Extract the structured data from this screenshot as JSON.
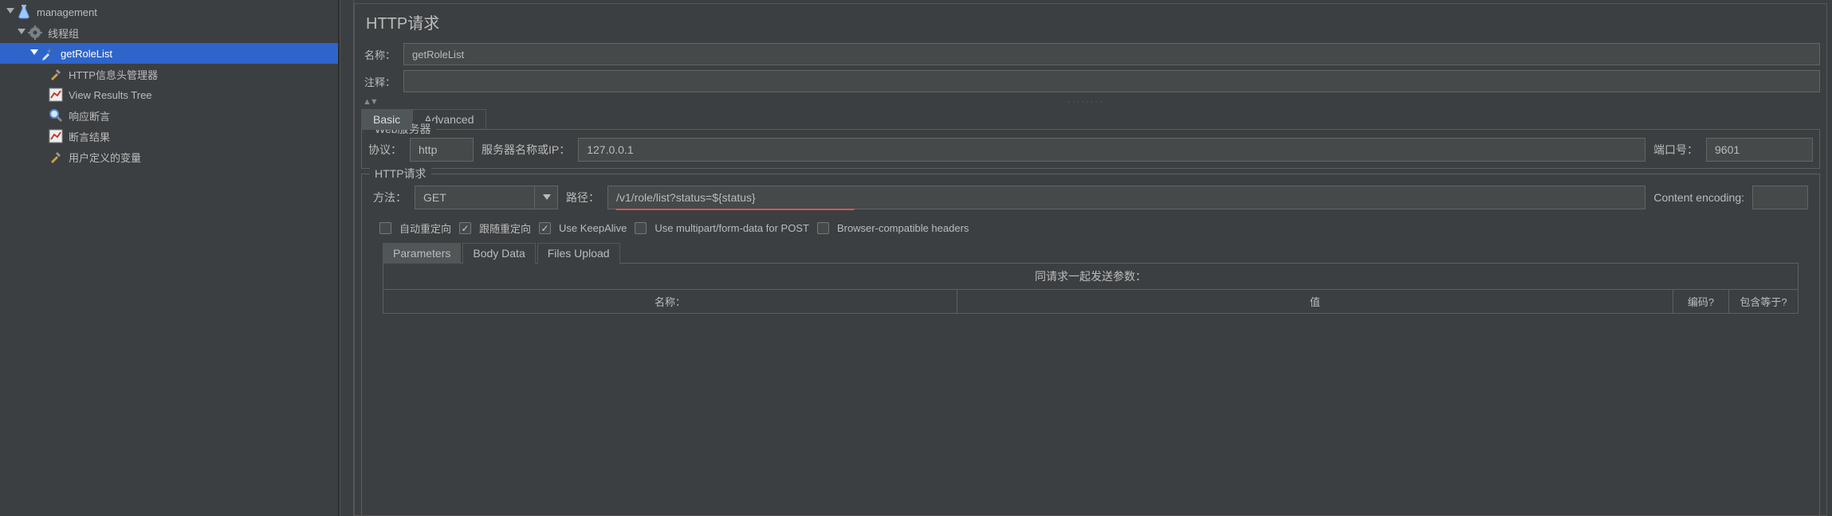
{
  "tree": {
    "root": "management",
    "threadGroup": "线程组",
    "item": "getRoleList",
    "children": [
      "HTTP信息头管理器",
      "View Results Tree",
      "响应断言",
      "断言结果",
      "用户定义的变量"
    ]
  },
  "panel": {
    "title": "HTTP请求"
  },
  "name": {
    "label": "名称：",
    "value": "getRoleList"
  },
  "comment": {
    "label": "注释：",
    "value": ""
  },
  "tabs": {
    "basic": "Basic",
    "advanced": "Advanced"
  },
  "web": {
    "legend": "Web服务器",
    "protocolLabel": "协议：",
    "protocol": "http",
    "hostLabel": "服务器名称或IP：",
    "host": "127.0.0.1",
    "portLabel": "端口号：",
    "port": "9601"
  },
  "http": {
    "legend": "HTTP请求",
    "methodLabel": "方法：",
    "method": "GET",
    "pathLabel": "路径：",
    "path": "/v1/role/list?status=${status}",
    "encLabel": "Content encoding:",
    "enc": ""
  },
  "checks": {
    "autoRedirect": "自动重定向",
    "followRedirect": "跟随重定向",
    "keepAlive": "Use KeepAlive",
    "multipart": "Use multipart/form-data for POST",
    "browserHeaders": "Browser-compatible headers"
  },
  "subtabs": {
    "params": "Parameters",
    "body": "Body Data",
    "files": "Files Upload"
  },
  "paramsBox": {
    "title": "同请求一起发送参数：",
    "colName": "名称：",
    "colValue": "值",
    "colEncode": "编码?",
    "colInclude": "包含等于?"
  }
}
